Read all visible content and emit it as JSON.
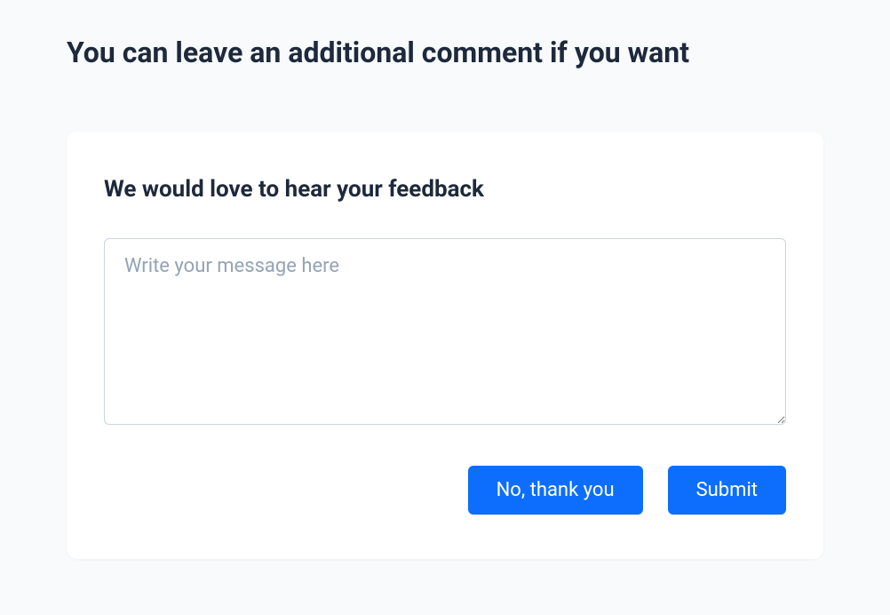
{
  "page": {
    "title": "You can leave an additional comment if you want"
  },
  "card": {
    "title": "We would love to hear your feedback",
    "textarea": {
      "placeholder": "Write your message here",
      "value": ""
    },
    "buttons": {
      "dismiss_label": "No, thank you",
      "submit_label": "Submit"
    }
  }
}
